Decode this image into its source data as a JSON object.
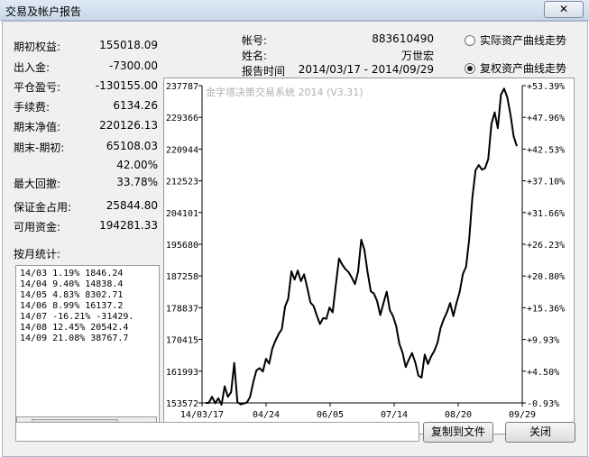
{
  "window": {
    "title": "交易及帐户报告",
    "close_label": "✕"
  },
  "summary": [
    {
      "label": "期初权益:",
      "value": "155018.09"
    },
    {
      "label": "出入金:",
      "value": "-7300.00"
    },
    {
      "label": "平仓盈亏:",
      "value": "-130155.00"
    },
    {
      "label": "手续费:",
      "value": "6134.26"
    },
    {
      "label": "期末净值:",
      "value": "220126.13"
    },
    {
      "label": "期末-期初:",
      "value": "65108.03"
    },
    {
      "label": "",
      "value": "42.00%"
    },
    {
      "label": "最大回撤:",
      "value": "33.78%"
    },
    {
      "label": "保证金占用:",
      "value": "25844.80"
    },
    {
      "label": "可用资金:",
      "value": "194281.33"
    }
  ],
  "monthly": {
    "label": "按月统计:",
    "rows": [
      "14/03  1.19%   1846.24",
      "14/04  9.40%   14838.4",
      "14/05  4.83%   8302.71",
      "14/06  8.99%   16137.2",
      "14/07 -16.21%  -31429.",
      "14/08  12.45%  20542.4",
      "14/09  21.08%  38767.7"
    ]
  },
  "account": {
    "account_label": "帐号:",
    "account_value": "883610490",
    "name_label": "姓名:",
    "name_value": "万世宏",
    "period_label": "报告时间",
    "period_value": "2014/03/17 - 2014/09/29"
  },
  "curve_options": {
    "actual": "实际资产曲线走势",
    "adjusted": "复权资产曲线走势",
    "selected": "adjusted"
  },
  "buttons": {
    "copy": "复制到文件",
    "close": "关闭"
  },
  "chart_data": {
    "type": "line",
    "title": "金字塔决策交易系统 2014 (V3.31)",
    "y_left_ticks": [
      "237787",
      "229366",
      "220944",
      "212523",
      "204101",
      "195680",
      "187258",
      "178837",
      "170415",
      "161993",
      "153572"
    ],
    "y_right_ticks": [
      "+53.39%",
      "+47.96%",
      "+42.53%",
      "+37.10%",
      "+31.66%",
      "+26.23%",
      "+20.80%",
      "+15.36%",
      "+9.93%",
      "+4.50%",
      "-0.93%"
    ],
    "ylim": [
      153572,
      237787
    ],
    "x_ticks": [
      "14/03/17",
      "04/24",
      "06/05",
      "07/14",
      "08/20",
      "09/29"
    ],
    "series": [
      {
        "values": [
          153572,
          153572,
          155200,
          153500,
          154800,
          153100,
          158000,
          155200,
          156400,
          164200,
          153800,
          153200,
          153400,
          153700,
          155200,
          159100,
          162200,
          162800,
          161900,
          165300,
          164000,
          168000,
          170100,
          171900,
          173200,
          179100,
          181200,
          188500,
          186300,
          188700,
          185900,
          187700,
          184100,
          180200,
          179300,
          176800,
          174500,
          176100,
          175900,
          178900,
          177600,
          184900,
          191900,
          190300,
          189100,
          188300,
          186900,
          185100,
          188400,
          196900,
          194200,
          188300,
          183200,
          182600,
          180600,
          176900,
          180000,
          183100,
          178200,
          176600,
          174000,
          169300,
          166900,
          163100,
          165100,
          166800,
          164400,
          160800,
          160300,
          166400,
          163900,
          165900,
          167400,
          169500,
          173500,
          175800,
          177700,
          180100,
          176600,
          180100,
          183000,
          187800,
          189700,
          197100,
          208100,
          215300,
          216700,
          215500,
          215900,
          218300,
          227600,
          230700,
          226500,
          235400,
          237000,
          234700,
          230000,
          224300,
          221700
        ]
      }
    ],
    "xlabel": "",
    "ylabel": "",
    "grid": false
  }
}
